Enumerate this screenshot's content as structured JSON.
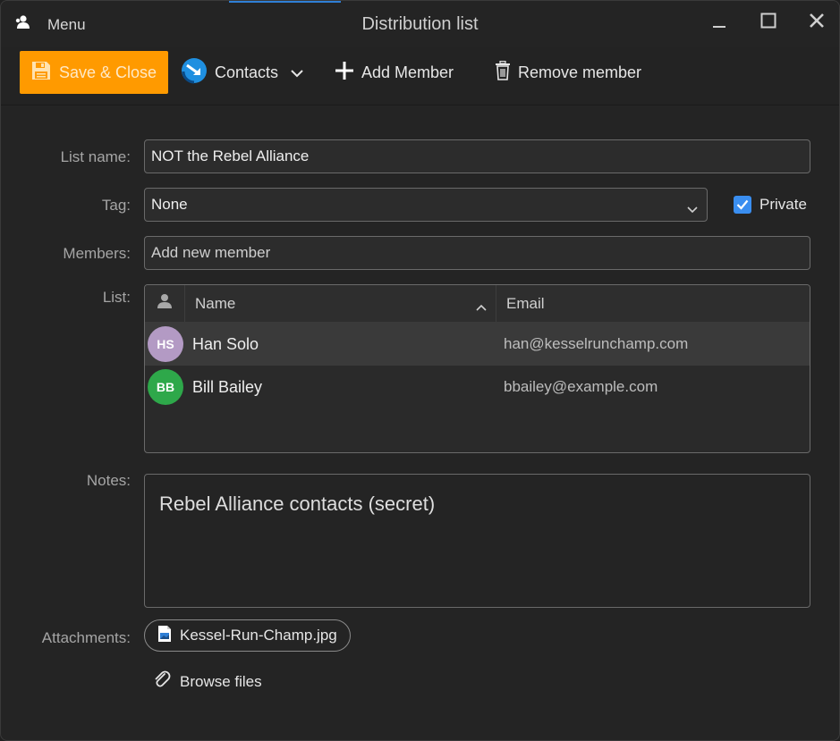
{
  "window": {
    "title": "Distribution list",
    "menu_label": "Menu",
    "menu_icon": "contacts-app-icon",
    "controls": [
      "minimize-icon",
      "maximize-icon",
      "close-icon"
    ]
  },
  "toolbar": {
    "save_label": "Save & Close",
    "contacts_label": "Contacts",
    "add_member_label": "Add Member",
    "remove_member_label": "Remove member"
  },
  "form": {
    "list_name_label": "List name:",
    "list_name_value": "NOT the Rebel Alliance",
    "tag_label": "Tag:",
    "tag_value": "None",
    "private_label": "Private",
    "private_checked": true,
    "members_label": "Members:",
    "members_placeholder": "Add new member",
    "list_label": "List:",
    "notes_label": "Notes:",
    "attachments_label": "Attachments:"
  },
  "members_table": {
    "columns": {
      "name": "Name",
      "email": "Email"
    },
    "rows": [
      {
        "initials": "HS",
        "name": "Han Solo",
        "email": "han@kesselrunchamp.com",
        "avatar_color": "#b39ac4",
        "selected": true
      },
      {
        "initials": "BB",
        "name": "Bill Bailey",
        "email": "bbailey@example.com",
        "avatar_color": "#2ea84a",
        "selected": false
      }
    ]
  },
  "notes": {
    "text": "Rebel Alliance contacts (secret)"
  },
  "attachments": {
    "files": [
      {
        "name": "Kessel-Run-Champ.jpg"
      }
    ],
    "browse_label": "Browse files"
  },
  "colors": {
    "accent": "#ff9a00",
    "checkbox": "#3a8ef0",
    "background": "#242424"
  }
}
